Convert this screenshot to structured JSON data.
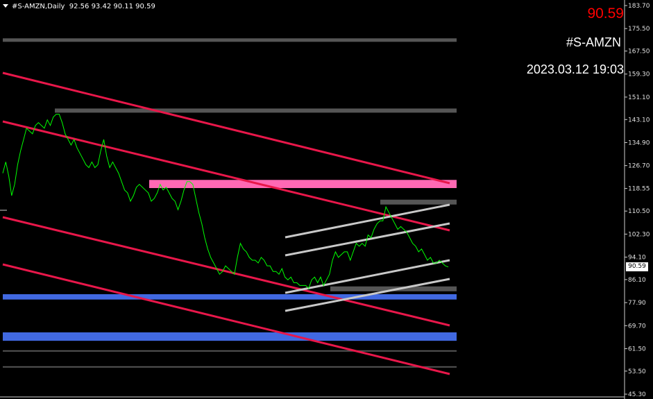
{
  "header": {
    "symbol_timeframe": "#S-AMZN,Daily",
    "ohlc": "92.56 93.42 90.11 90.59"
  },
  "overlay": {
    "last_price": "90.59",
    "symbol": "#S-AMZN",
    "datetime": "2023.03.12 19:03"
  },
  "price_axis": {
    "current_price_tag": "90.59",
    "tick_labels": [
      "183.70",
      "175.50",
      "167.50",
      "159.30",
      "151.10",
      "143.10",
      "134.90",
      "126.70",
      "118.55",
      "110.50",
      "102.30",
      "94.10",
      "86.10",
      "77.90",
      "69.70",
      "61.50",
      "53.50",
      "45.30"
    ]
  },
  "colors": {
    "background": "#000000",
    "price_line": "#00ff00",
    "channel_lines": "#e8174a",
    "resistance_zone": "#ff69b4",
    "support_zone": "#4169e1",
    "gray_levels": "#555555",
    "up_channel": "#c8c8c8",
    "last_price_text": "#ff0000"
  },
  "chart_data": {
    "type": "line",
    "title": "#S-AMZN,Daily",
    "ylim": [
      45.3,
      183.7
    ],
    "series": [
      {
        "values": [
          124,
          128,
          123,
          116,
          120,
          127,
          132,
          136,
          140,
          139,
          138,
          141,
          142,
          141,
          140,
          143,
          141,
          144,
          145,
          145,
          142,
          138,
          136,
          134,
          136,
          133,
          131,
          129,
          127,
          126,
          128,
          126,
          127,
          132,
          136,
          130,
          126,
          128,
          126,
          124,
          121,
          118,
          117,
          114,
          116,
          119,
          120,
          119,
          118,
          117,
          114,
          115,
          117,
          120,
          118,
          119,
          117,
          115,
          114,
          111,
          114,
          118,
          121,
          121,
          120,
          115,
          110,
          106,
          101,
          97,
          94,
          92,
          90,
          88,
          89,
          91,
          90,
          89,
          88,
          94,
          99,
          97,
          96,
          94,
          93,
          93,
          92,
          94,
          93,
          91,
          91,
          89,
          89,
          88,
          90,
          87,
          86,
          87,
          85,
          85,
          84,
          84,
          84,
          83,
          86,
          87,
          85,
          87,
          84,
          86,
          88,
          93,
          96,
          94,
          95,
          96,
          96,
          93,
          96,
          99,
          98,
          99,
          98,
          102,
          101,
          104,
          106,
          107,
          107,
          112,
          110,
          108,
          106,
          104,
          105,
          104,
          103,
          101,
          99,
          98,
          96,
          97,
          95,
          93,
          94,
          92,
          92,
          93,
          92,
          91,
          90.59
        ]
      }
    ],
    "levels": {
      "gray": [
        171.4,
        146.3,
        113.7,
        82.8,
        60.7,
        55.0
      ],
      "resistance_zone": [
        118.7,
        121.6
      ],
      "support_zones": [
        [
          79.0,
          80.9
        ],
        [
          64.3,
          67.3
        ]
      ]
    },
    "grid": false
  }
}
